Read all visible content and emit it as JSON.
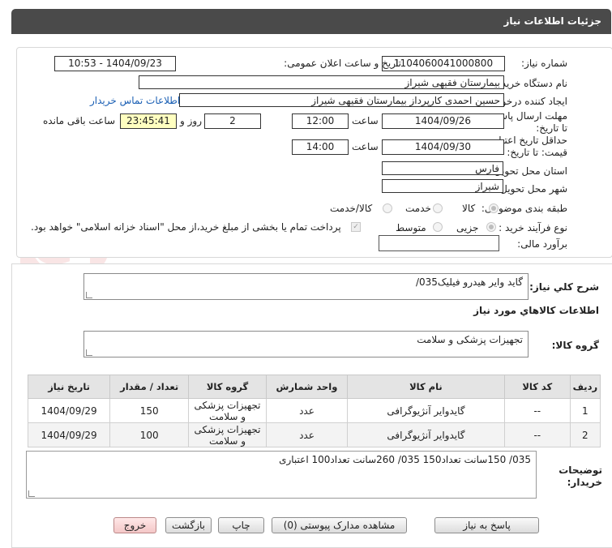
{
  "header": {
    "title": "جزئیات اطلاعات نیاز"
  },
  "form": {
    "need_number_label": "شماره نیاز:",
    "need_number": "1104060041000800",
    "announce_label": "تاریخ و ساعت اعلان عمومی:",
    "announce_value": "1404/09/23 - 10:53",
    "buyer_org_label": "نام دستگاه خریدار:",
    "buyer_org": "بیمارستان فقیهی شیراز",
    "creator_label": "ایجاد کننده درخواست:",
    "creator": "حسین احمدی کارپرداز بیمارستان فقیهی شیراز",
    "contact_link": "اطلاعات تماس خریدار",
    "reply_deadline_label": "مهلت ارسال پاسخ: تا تاریخ:",
    "reply_date": "1404/09/26",
    "time_label": "ساعت",
    "reply_time": "12:00",
    "days_value": "2",
    "days_label": "روز و",
    "remaining_time": "23:45:41",
    "remaining_label": "ساعت باقی مانده",
    "validity_label": "حداقل تاریخ اعتبار قیمت: تا تاریخ:",
    "validity_date": "1404/09/30",
    "validity_time": "14:00",
    "province_label": "استان محل تحویل:",
    "province": "فارس",
    "city_label": "شهر محل تحویل:",
    "city": "شیراز",
    "category_label": "طبقه بندی موضوعی:",
    "category_options": [
      "کالا",
      "خدمت",
      "کالا/خدمت"
    ],
    "process_label": "نوع فرآیند خرید :",
    "process_options": [
      "جزیی",
      "متوسط"
    ],
    "payment_note": "پرداخت تمام یا بخشی از مبلغ خرید،از محل \"اسناد خزانه اسلامی\" خواهد بود.",
    "estimate_label": "برآورد مالی:",
    "estimate_value": ""
  },
  "summary": {
    "label": "شرح کلي نياز:",
    "value": "گاید وایر هیدرو فیلیک035/"
  },
  "goods": {
    "section_title": "اطلاعات كالاهاي مورد نياز",
    "group_label": "گروه کالا:",
    "group_value": "تجهیزات پزشکی و سلامت",
    "columns": [
      "ردیف",
      "کد کالا",
      "نام کالا",
      "واحد شمارش",
      "گروه کالا",
      "تعداد / مقدار",
      "تاریخ نیاز"
    ],
    "rows": [
      {
        "index": "1",
        "code": "--",
        "name": "گایدوایر آنژیوگرافی",
        "unit": "عدد",
        "group": "تجهیزات پزشکی و سلامت",
        "qty": "150",
        "date": "1404/09/29"
      },
      {
        "index": "2",
        "code": "--",
        "name": "گایدوایر آنژیوگرافی",
        "unit": "عدد",
        "group": "تجهیزات پزشکی و سلامت",
        "qty": "100",
        "date": "1404/09/29"
      }
    ]
  },
  "notes": {
    "label": "توضیحات خریدار:",
    "value": "035/    150سانت تعداد150   035/  260سانت تعداد100   اعتباری"
  },
  "buttons": {
    "reply": "پاسخ به نیاز",
    "attachments": "مشاهده مدارک پیوستی (0)",
    "print": "چاپ",
    "back": "بازگشت",
    "exit": "خروج"
  },
  "watermark": {
    "text": "AriaTender.neT"
  },
  "colors": {
    "header_bg": "#4a4a4a",
    "link": "#1a5fb4",
    "time_bg": "#ffffc0"
  }
}
